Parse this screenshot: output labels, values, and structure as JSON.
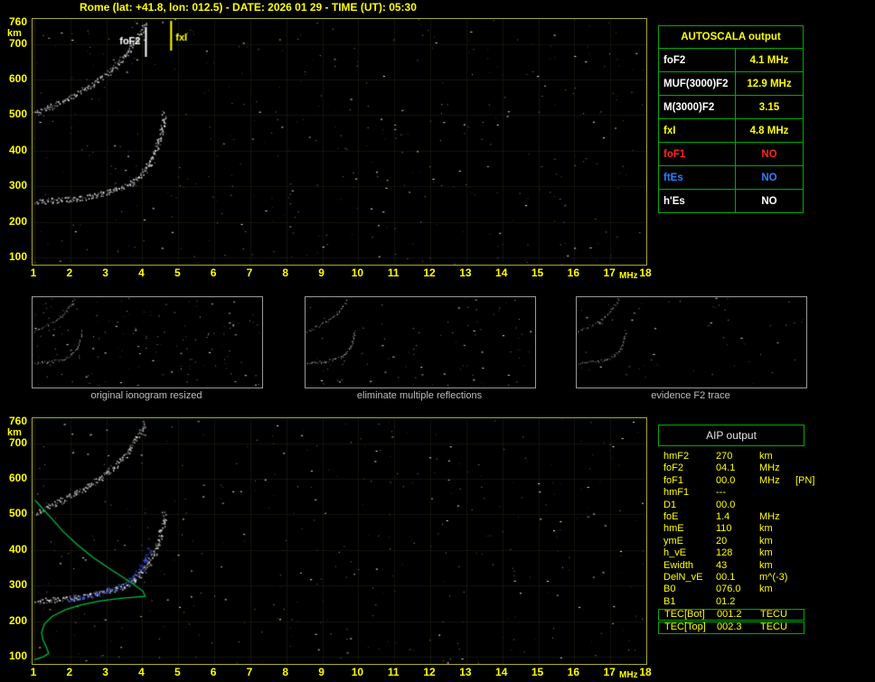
{
  "header": {
    "title": "Rome (lat: +41.8, lon: 012.5) - DATE: 2026 01 29 - TIME (UT): 05:30"
  },
  "palette": {
    "background": "#000000",
    "accent_yellow": "#ffff00",
    "table_border_green": "#00aa00",
    "alert_red": "#ff2222",
    "info_blue": "#2f7fff",
    "trace_white": "#f2f2f2",
    "profile_green": "#00bb3c",
    "restored_blue": "#4a5cff"
  },
  "autoscala": {
    "title": "AUTOSCALA output",
    "rows": [
      {
        "param": "foF2",
        "value": "4.1 MHz",
        "param_color": "#ffffff",
        "value_color": "#ffff00"
      },
      {
        "param": "MUF(3000)F2",
        "value": "12.9 MHz",
        "param_color": "#ffffff",
        "value_color": "#ffff00"
      },
      {
        "param": "M(3000)F2",
        "value": "3.15",
        "param_color": "#ffffff",
        "value_color": "#ffff00"
      },
      {
        "param": "fxI",
        "value": "4.8 MHz",
        "param_color": "#ffff00",
        "value_color": "#ffff00"
      },
      {
        "param": "foF1",
        "value": "NO",
        "param_color": "#ff2222",
        "value_color": "#ff2222"
      },
      {
        "param": "ftEs",
        "value": "NO",
        "param_color": "#2f7fff",
        "value_color": "#2f7fff"
      },
      {
        "param": "h'Es",
        "value": "NO",
        "param_color": "#ffffff",
        "value_color": "#ffffff"
      }
    ]
  },
  "aip": {
    "title": "AIP output",
    "rows": [
      {
        "param": "hmF2",
        "value": "270",
        "unit": "km",
        "extra": "",
        "boxed": false
      },
      {
        "param": "foF2",
        "value": "04.1",
        "unit": "MHz",
        "extra": "",
        "boxed": false
      },
      {
        "param": "foF1",
        "value": "00.0",
        "unit": "MHz",
        "extra": "[PN]",
        "boxed": false
      },
      {
        "param": "hmF1",
        "value": "---",
        "unit": "",
        "extra": "",
        "boxed": false
      },
      {
        "param": "D1",
        "value": "00.0",
        "unit": "",
        "extra": "",
        "boxed": false
      },
      {
        "param": "foE",
        "value": "1.4",
        "unit": "MHz",
        "extra": "",
        "boxed": false
      },
      {
        "param": "hmE",
        "value": "110",
        "unit": "km",
        "extra": "",
        "boxed": false
      },
      {
        "param": "ymE",
        "value": "20",
        "unit": "km",
        "extra": "",
        "boxed": false
      },
      {
        "param": "h_vE",
        "value": "128",
        "unit": "km",
        "extra": "",
        "boxed": false
      },
      {
        "param": "Ewidth",
        "value": "43",
        "unit": "km",
        "extra": "",
        "boxed": false
      },
      {
        "param": "DelN_vE",
        "value": "00.1",
        "unit": "m^(-3)",
        "extra": "",
        "boxed": false
      },
      {
        "param": "B0",
        "value": "076.0",
        "unit": "km",
        "extra": "",
        "boxed": false
      },
      {
        "param": "B1",
        "value": "01.2",
        "unit": "",
        "extra": "",
        "boxed": false
      },
      {
        "param": "TEC[Bot]",
        "value": "001.2",
        "unit": "TECU",
        "extra": "",
        "boxed": true
      },
      {
        "param": "TEC[Top]",
        "value": "002.3",
        "unit": "TECU",
        "extra": "",
        "boxed": true
      }
    ]
  },
  "thumbnails": [
    {
      "caption": "original ionogram resized",
      "noise": 150,
      "series": [
        "F2 trace",
        "F2 second reflection"
      ]
    },
    {
      "caption": "eliminate multiple reflections",
      "noise": 90,
      "series": [
        "F2 trace",
        "F2 second reflection"
      ]
    },
    {
      "caption": "evidence F2 trace",
      "noise": 55,
      "series": [
        "F2 trace",
        "F2 second reflection"
      ]
    }
  ],
  "chart_data": [
    {
      "id": "ionogram_main",
      "type": "scatter",
      "title": "scaled ionogram with foF2 / fxI markers",
      "xlabel": "MHz",
      "ylabel": "km",
      "xlim": [
        0.95,
        18.0
      ],
      "ylim": [
        80,
        770
      ],
      "x_ticks": [
        1,
        2,
        3,
        4,
        5,
        6,
        7,
        8,
        9,
        10,
        11,
        12,
        13,
        14,
        15,
        16,
        17,
        18
      ],
      "y_ticks": [
        760,
        700,
        600,
        500,
        400,
        300,
        200,
        100
      ],
      "grid": true,
      "noise_points": 420,
      "markers": [
        {
          "label": "foF2",
          "freq_mhz": 4.1,
          "color": "#ffffff"
        },
        {
          "label": "fxI",
          "freq_mhz": 4.8,
          "color": "#ffff00"
        }
      ],
      "series": [
        {
          "name": "F2 trace",
          "color": "#f2f2f2",
          "style": "scatter",
          "points": [
            [
              1.05,
              258
            ],
            [
              1.35,
              260
            ],
            [
              1.7,
              262
            ],
            [
              2.1,
              266
            ],
            [
              2.5,
              272
            ],
            [
              2.9,
              280
            ],
            [
              3.25,
              290
            ],
            [
              3.55,
              302
            ],
            [
              3.8,
              318
            ],
            [
              4.0,
              338
            ],
            [
              4.18,
              362
            ],
            [
              4.33,
              392
            ],
            [
              4.45,
              425
            ],
            [
              4.53,
              458
            ],
            [
              4.58,
              488
            ],
            [
              4.6,
              505
            ]
          ]
        },
        {
          "name": "F2 second reflection",
          "color": "#dedede",
          "style": "scatter",
          "points": [
            [
              1.0,
              505
            ],
            [
              1.35,
              520
            ],
            [
              1.75,
              540
            ],
            [
              2.15,
              560
            ],
            [
              2.5,
              580
            ],
            [
              2.8,
              600
            ],
            [
              3.1,
              624
            ],
            [
              3.35,
              650
            ],
            [
              3.58,
              678
            ],
            [
              3.78,
              706
            ],
            [
              3.95,
              732
            ],
            [
              4.06,
              756
            ]
          ]
        }
      ]
    },
    {
      "id": "ionogram_profile",
      "type": "scatter",
      "title": "ionogram with restored trace and electron density profile",
      "xlabel": "MHz",
      "ylabel": "km",
      "xlim": [
        0.95,
        18.0
      ],
      "ylim": [
        80,
        770
      ],
      "x_ticks": [
        1,
        2,
        3,
        4,
        5,
        6,
        7,
        8,
        9,
        10,
        11,
        12,
        13,
        14,
        15,
        16,
        17,
        18
      ],
      "y_ticks": [
        760,
        700,
        600,
        500,
        400,
        300,
        200,
        100
      ],
      "grid": true,
      "noise_points": 380,
      "markers": [],
      "series": [
        {
          "name": "F2 trace",
          "color": "#f2f2f2",
          "style": "scatter",
          "points": [
            [
              1.05,
              258
            ],
            [
              1.35,
              260
            ],
            [
              1.7,
              262
            ],
            [
              2.1,
              266
            ],
            [
              2.5,
              272
            ],
            [
              2.9,
              280
            ],
            [
              3.25,
              290
            ],
            [
              3.55,
              302
            ],
            [
              3.8,
              318
            ],
            [
              4.0,
              338
            ],
            [
              4.18,
              362
            ],
            [
              4.33,
              392
            ],
            [
              4.45,
              425
            ],
            [
              4.53,
              458
            ],
            [
              4.58,
              488
            ],
            [
              4.6,
              505
            ]
          ]
        },
        {
          "name": "F2 second reflection",
          "color": "#dedede",
          "style": "scatter",
          "points": [
            [
              1.0,
              505
            ],
            [
              1.35,
              520
            ],
            [
              1.75,
              540
            ],
            [
              2.15,
              560
            ],
            [
              2.5,
              580
            ],
            [
              2.8,
              600
            ],
            [
              3.1,
              624
            ],
            [
              3.35,
              650
            ],
            [
              3.58,
              678
            ],
            [
              3.78,
              706
            ],
            [
              3.95,
              732
            ],
            [
              4.06,
              756
            ]
          ]
        },
        {
          "name": "restored trace",
          "color": "#4a5cff",
          "style": "scatter",
          "points": [
            [
              1.9,
              263
            ],
            [
              2.3,
              269
            ],
            [
              2.7,
              277
            ],
            [
              3.05,
              287
            ],
            [
              3.35,
              299
            ],
            [
              3.6,
              313
            ],
            [
              3.8,
              330
            ],
            [
              3.97,
              352
            ],
            [
              4.1,
              378
            ],
            [
              4.2,
              405
            ]
          ]
        },
        {
          "name": "electron density profile",
          "color": "#00bb3c",
          "style": "line",
          "points": [
            [
              1.0,
              92
            ],
            [
              1.25,
              100
            ],
            [
              1.4,
              110
            ],
            [
              1.33,
              128
            ],
            [
              1.24,
              148
            ],
            [
              1.2,
              168
            ],
            [
              1.28,
              192
            ],
            [
              1.5,
              214
            ],
            [
              1.85,
              232
            ],
            [
              2.3,
              246
            ],
            [
              2.85,
              257
            ],
            [
              3.4,
              264
            ],
            [
              3.85,
              268
            ],
            [
              4.08,
              270
            ],
            [
              4.02,
              284
            ],
            [
              3.78,
              302
            ],
            [
              3.45,
              324
            ],
            [
              3.05,
              350
            ],
            [
              2.62,
              380
            ],
            [
              2.2,
              414
            ],
            [
              1.8,
              452
            ],
            [
              1.45,
              492
            ],
            [
              1.18,
              522
            ],
            [
              1.02,
              540
            ]
          ]
        }
      ]
    }
  ]
}
